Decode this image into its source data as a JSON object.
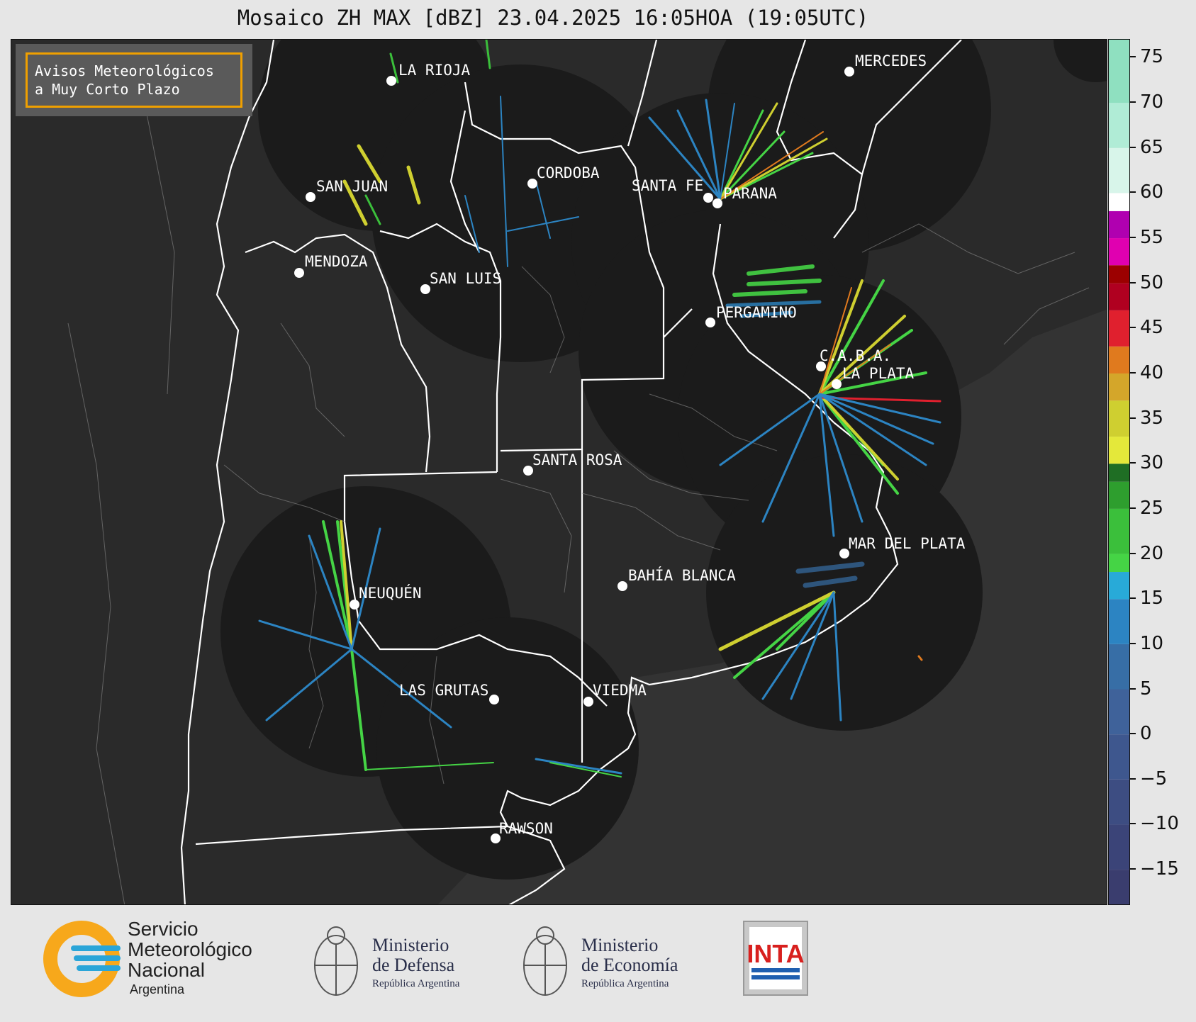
{
  "title": "Mosaico ZH MAX [dBZ] 23.04.2025 16:05HOA (19:05UTC)",
  "badge": {
    "line1": "Avisos Meteorológicos",
    "line2": "a Muy Corto Plazo",
    "border_color": "#f0a000"
  },
  "cities": [
    {
      "name": "LA RIOJA"
    },
    {
      "name": "MERCEDES"
    },
    {
      "name": "SAN JUAN"
    },
    {
      "name": "CORDOBA"
    },
    {
      "name": "SANTA FE"
    },
    {
      "name": "PARANA"
    },
    {
      "name": "MENDOZA"
    },
    {
      "name": "SAN LUIS"
    },
    {
      "name": "PERGAMINO"
    },
    {
      "name": "C.A.B.A."
    },
    {
      "name": "LA PLATA"
    },
    {
      "name": "SANTA ROSA"
    },
    {
      "name": "NEUQUÉN"
    },
    {
      "name": "MAR DEL PLATA"
    },
    {
      "name": "BAHÍA BLANCA"
    },
    {
      "name": "LAS GRUTAS"
    },
    {
      "name": "VIEDMA"
    },
    {
      "name": "RAWSON"
    }
  ],
  "colorbar": {
    "unit": "dBZ",
    "min": -19,
    "max": 77,
    "ticks": [
      "75",
      "70",
      "65",
      "60",
      "55",
      "50",
      "45",
      "40",
      "35",
      "30",
      "25",
      "20",
      "15",
      "10",
      "5",
      "0",
      "−5",
      "−10",
      "−15"
    ],
    "tick_values": [
      75,
      70,
      65,
      60,
      55,
      50,
      45,
      40,
      35,
      30,
      25,
      20,
      15,
      10,
      5,
      0,
      -5,
      -10,
      -15
    ],
    "stops": [
      {
        "from": -19,
        "to": -15,
        "color": "#3a3d6e"
      },
      {
        "from": -15,
        "to": -10,
        "color": "#3b4478"
      },
      {
        "from": -10,
        "to": -5,
        "color": "#3d4d82"
      },
      {
        "from": -5,
        "to": 0,
        "color": "#3e578e"
      },
      {
        "from": 0,
        "to": 5,
        "color": "#3f629a"
      },
      {
        "from": 5,
        "to": 10,
        "color": "#376ea6"
      },
      {
        "from": 10,
        "to": 15,
        "color": "#2c84c2"
      },
      {
        "from": 15,
        "to": 18,
        "color": "#28aad8"
      },
      {
        "from": 18,
        "to": 20,
        "color": "#45d445"
      },
      {
        "from": 20,
        "to": 25,
        "color": "#3bbf3b"
      },
      {
        "from": 25,
        "to": 28,
        "color": "#2e9e2e"
      },
      {
        "from": 28,
        "to": 30,
        "color": "#1f6e24"
      },
      {
        "from": 30,
        "to": 33,
        "color": "#e4e83a"
      },
      {
        "from": 33,
        "to": 37,
        "color": "#cfcf30"
      },
      {
        "from": 37,
        "to": 40,
        "color": "#d4a62a"
      },
      {
        "from": 40,
        "to": 43,
        "color": "#e07a1e"
      },
      {
        "from": 43,
        "to": 47,
        "color": "#e0202e"
      },
      {
        "from": 47,
        "to": 50,
        "color": "#b00020"
      },
      {
        "from": 50,
        "to": 52,
        "color": "#9c0000"
      },
      {
        "from": 52,
        "to": 55,
        "color": "#e000b0"
      },
      {
        "from": 55,
        "to": 58,
        "color": "#b000b0"
      },
      {
        "from": 58,
        "to": 60,
        "color": "#ffffff"
      },
      {
        "from": 60,
        "to": 65,
        "color": "#d8f5ea"
      },
      {
        "from": 65,
        "to": 70,
        "color": "#b0ecd6"
      },
      {
        "from": 70,
        "to": 77,
        "color": "#8fe0c0"
      }
    ]
  },
  "logos": {
    "smn_line1": "Servicio",
    "smn_line2": "Meteorológico",
    "smn_line3": "Nacional",
    "smn_line4": "Argentina",
    "defensa_line1": "Ministerio",
    "defensa_line2": "de Defensa",
    "defensa_line3": "República Argentina",
    "economia_line1": "Ministerio",
    "economia_line2": "de Economía",
    "economia_line3": "República Argentina",
    "inta": "INTA",
    "smn_orange": "#f7a81b",
    "smn_blue": "#2aa5d8",
    "inta_red": "#d8201e",
    "inta_blue": "#1f5fb0"
  }
}
